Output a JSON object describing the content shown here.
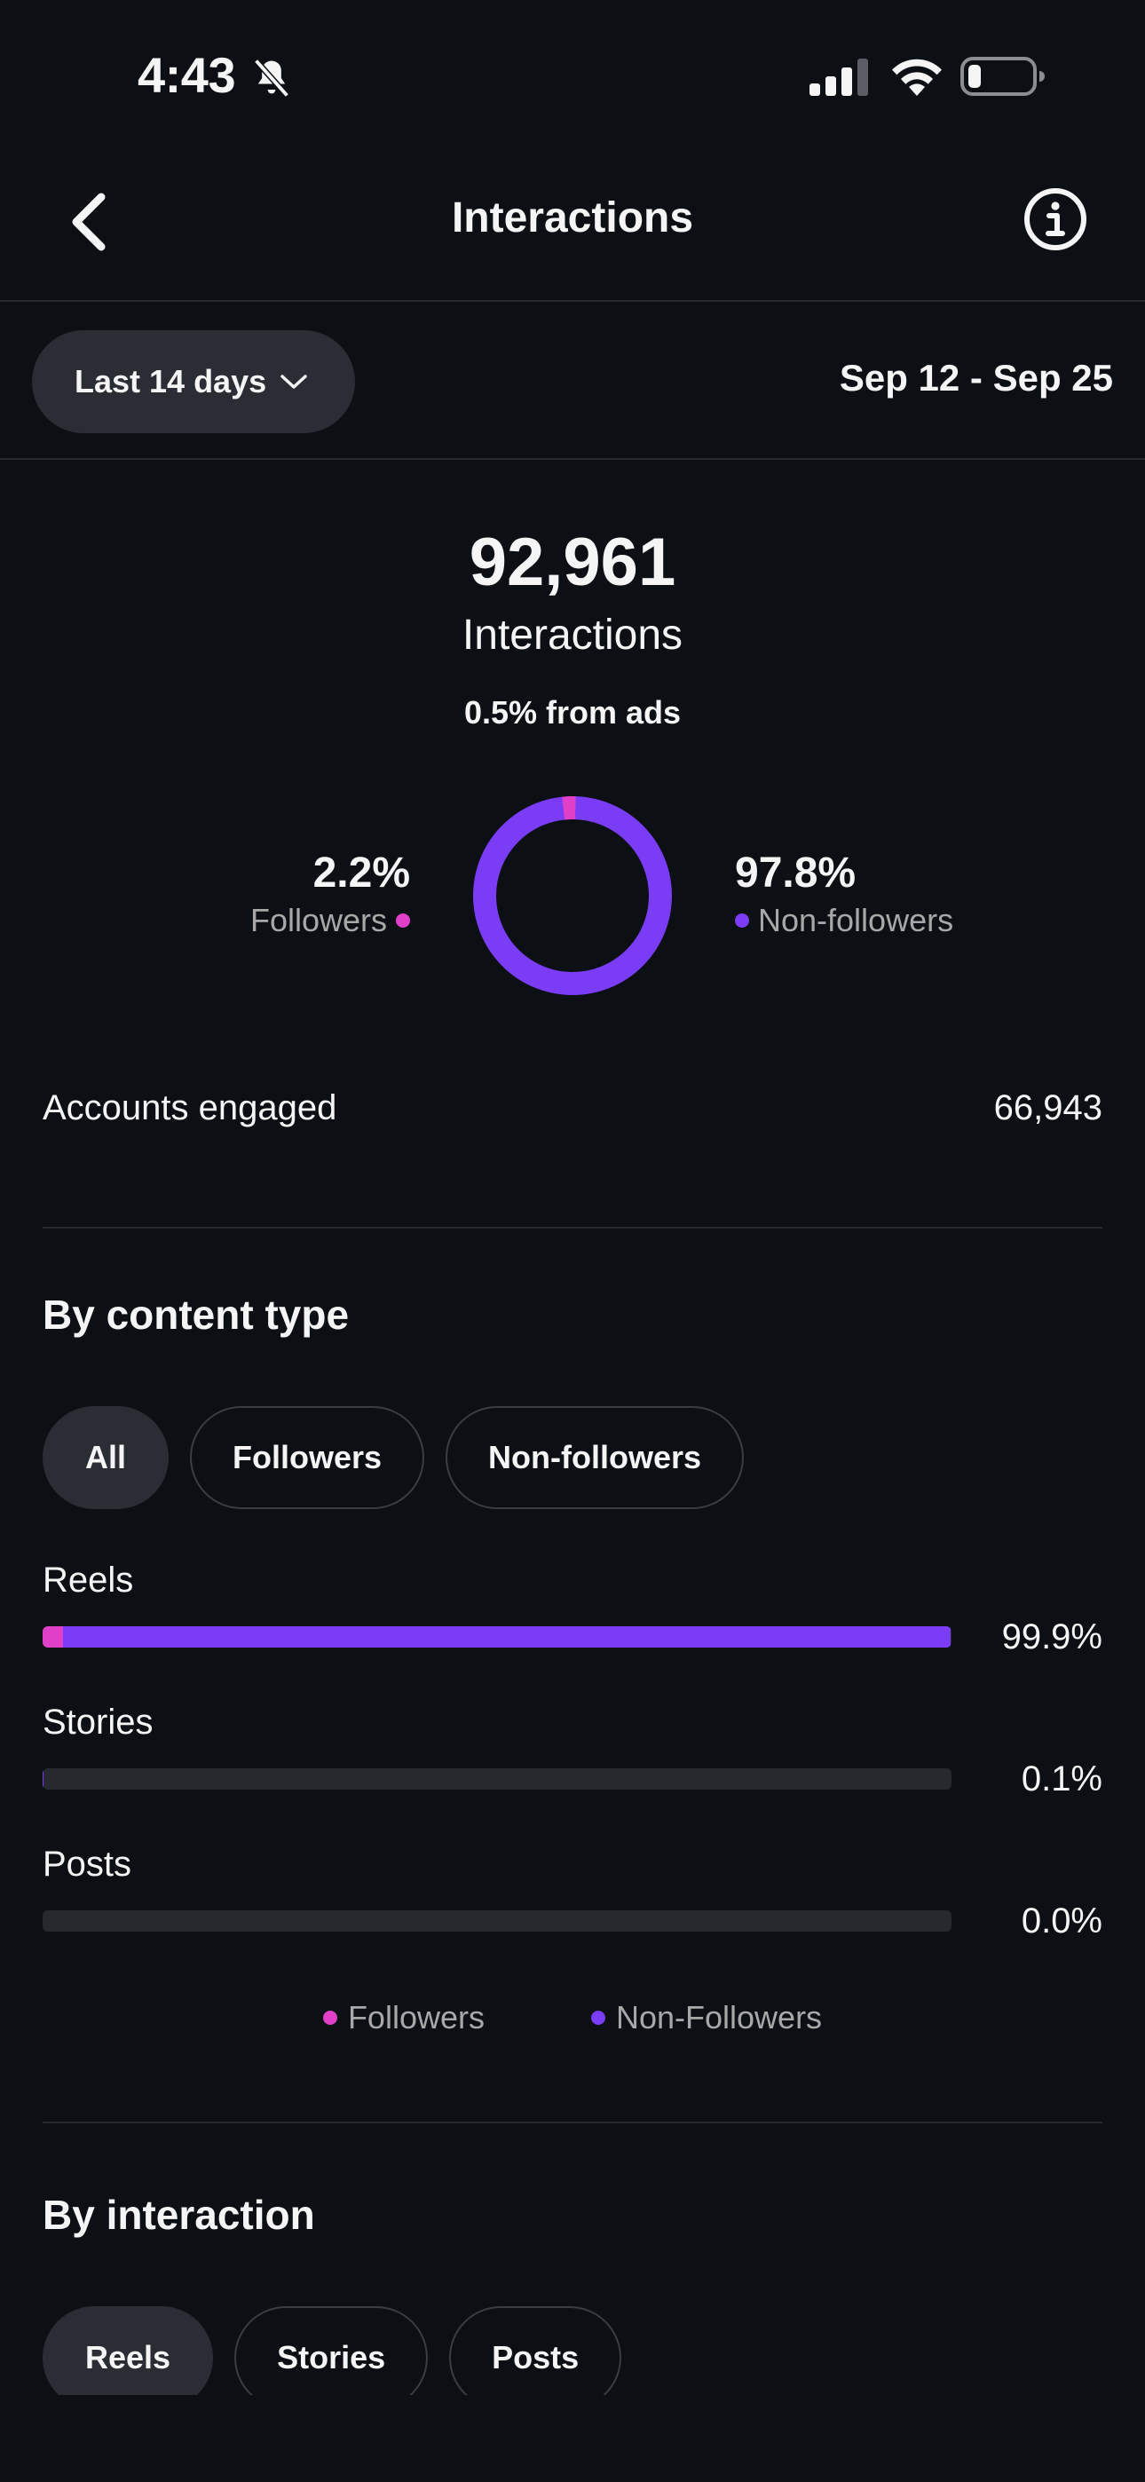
{
  "status_bar": {
    "time": "4:43"
  },
  "header": {
    "title": "Interactions"
  },
  "range": {
    "selected": "Last 14 days",
    "dates": "Sep 12 - Sep 25"
  },
  "summary": {
    "total": "92,961",
    "label": "Interactions",
    "ads_note": "0.5% from ads"
  },
  "audience": {
    "followers_pct": "2.2%",
    "followers_label": "Followers",
    "followers_fraction": 0.022,
    "nonfollowers_pct": "97.8%",
    "nonfollowers_label": "Non-followers",
    "nonfollowers_fraction": 0.978
  },
  "accounts_engaged": {
    "label": "Accounts engaged",
    "value": "66,943"
  },
  "by_content_type": {
    "title": "By content type",
    "filters": [
      "All",
      "Followers",
      "Non-followers"
    ],
    "rows": [
      {
        "label": "Reels",
        "pct": "99.9%",
        "followers_fraction": 0.022,
        "total_fraction": 0.999
      },
      {
        "label": "Stories",
        "pct": "0.1%",
        "followers_fraction": 0,
        "total_fraction": 0.001
      },
      {
        "label": "Posts",
        "pct": "0.0%",
        "followers_fraction": 0,
        "total_fraction": 0.0
      }
    ],
    "legend_followers": "Followers",
    "legend_nonfollowers": "Non-Followers"
  },
  "by_interaction": {
    "title": "By interaction",
    "filters": [
      "Reels",
      "Stories",
      "Posts"
    ]
  },
  "colors": {
    "followers": "#e040c8",
    "nonfollowers": "#7a3cf4",
    "background": "#0c1014"
  }
}
